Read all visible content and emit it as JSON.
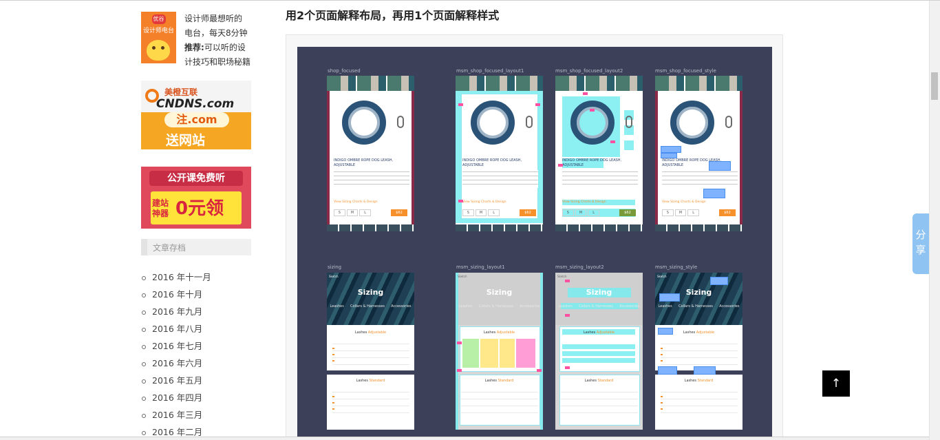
{
  "sidebar": {
    "radio_promo": {
      "thumb_logo": "优谷",
      "thumb_caption": "设计师电台",
      "line1": "设计师最想听的",
      "line2": "电台，每天8分钟",
      "line3_label": "推荐:",
      "line3_text": "可以听的设",
      "line4": "计技巧和职场秘籍"
    },
    "ad_cndns": {
      "brand": "美橙互联",
      "domain": "CNDNS.com",
      "pill": "注.com",
      "slogan": "送网站"
    },
    "ad_course": {
      "ribbon": "公开课免费听",
      "small": "建站神器",
      "big": "0元领"
    },
    "archive_title": "文章存档",
    "archive_months": [
      "2016 年十一月",
      "2016 年十月",
      "2016 年九月",
      "2016 年八月",
      "2016 年七月",
      "2016 年六月",
      "2016 年五月",
      "2016 年四月",
      "2016 年三月",
      "2016 年二月"
    ]
  },
  "article": {
    "heading": "用2个页面解释布局，再用1个页面解释样式",
    "figure": {
      "labels": [
        "shop_focused",
        "msm_shop_focused_layout1",
        "msm_shop_focused_layout2",
        "msm_shop_focused_style",
        "sizing",
        "msm_sizing_layout1",
        "msm_sizing_layout2",
        "msm_sizing_style"
      ],
      "product_title": "INDIGO OMBRE ROPE DOG LEASH, ADJUSTABLE",
      "size_chart_link": "View Sizing Charts & Design",
      "sizes": [
        "S",
        "M",
        "L"
      ],
      "price": "$62",
      "phone_status": "Sketch",
      "phone_title": "Sizing",
      "phone_tabs": [
        "Leashes",
        "Collars & Harnesses",
        "Accessories"
      ],
      "section_adjustable_prefix": "Lashes",
      "section_adjustable_tag": "Adjustable",
      "section_standard_prefix": "Lashes",
      "section_standard_tag": "Standard"
    }
  },
  "float": {
    "share_line1": "分",
    "share_line2": "享",
    "back_to_top": "↑"
  },
  "colors": {
    "canvas": "#3c4159",
    "accent_orange": "#f5902b",
    "overlay_cyan": "#78ecf0",
    "marker_pink": "#ff4fa0",
    "share_blue": "#8fc4f2"
  }
}
